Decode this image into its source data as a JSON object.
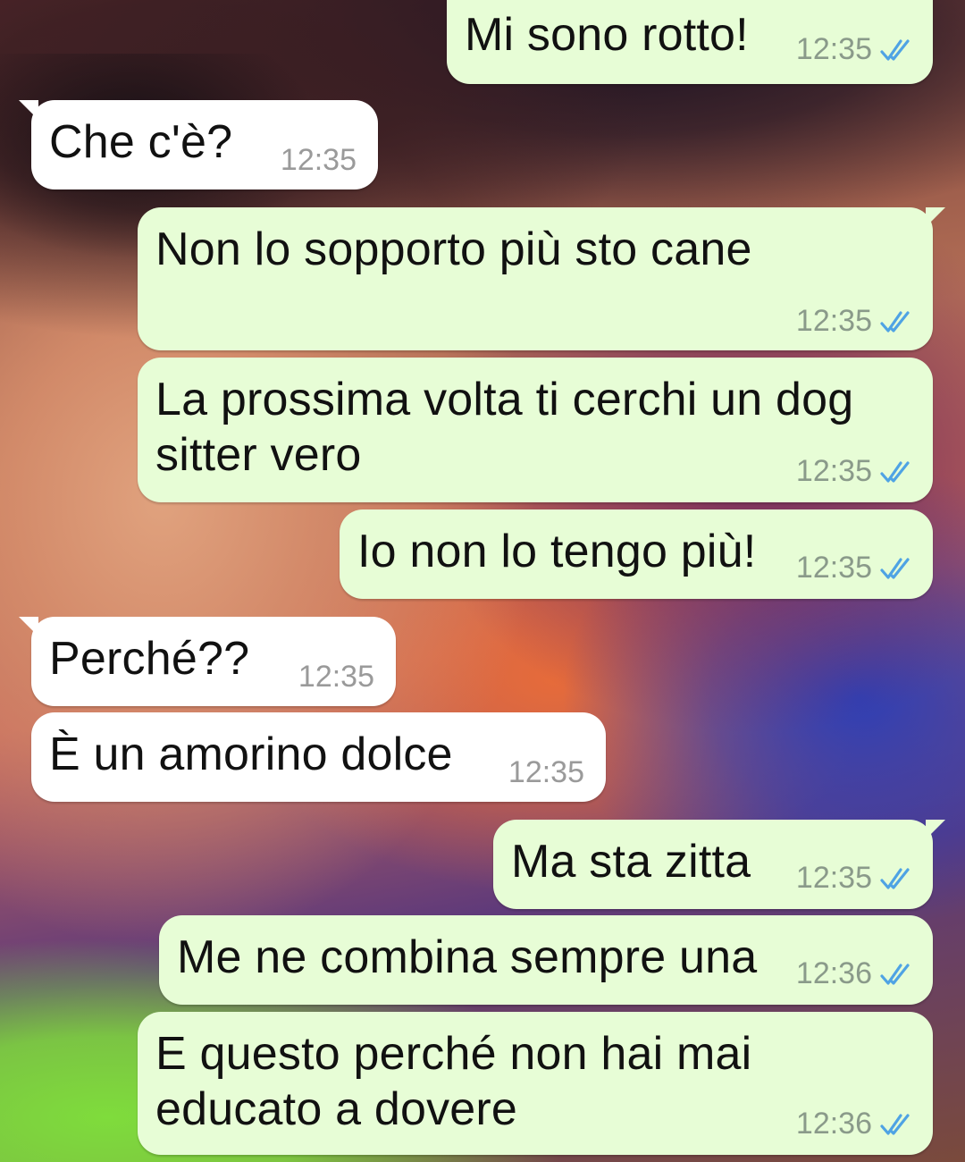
{
  "colors": {
    "outgoing_bubble": "#e7fdd6",
    "incoming_bubble": "#ffffff",
    "read_ticks": "#4fa3e4"
  },
  "messages": [
    {
      "direction": "out",
      "text": "Mi sono rotto!",
      "time": "12:35",
      "status_icon": "double-check-read-icon"
    },
    {
      "direction": "in",
      "text": "Che c'è?",
      "time": "12:35"
    },
    {
      "direction": "out",
      "text": "Non lo sopporto più sto cane",
      "time": "12:35",
      "status_icon": "double-check-read-icon"
    },
    {
      "direction": "out",
      "text": "La prossima volta ti cerchi un dog\nsitter vero",
      "time": "12:35",
      "status_icon": "double-check-read-icon"
    },
    {
      "direction": "out",
      "text": "Io non lo tengo più!",
      "time": "12:35",
      "status_icon": "double-check-read-icon"
    },
    {
      "direction": "in",
      "text": "Perché??",
      "time": "12:35"
    },
    {
      "direction": "in",
      "text": "È un amorino dolce",
      "time": "12:35"
    },
    {
      "direction": "out",
      "text": "Ma sta zitta",
      "time": "12:35",
      "status_icon": "double-check-read-icon"
    },
    {
      "direction": "out",
      "text": "Me ne combina sempre una",
      "time": "12:36",
      "status_icon": "double-check-read-icon"
    },
    {
      "direction": "out",
      "text": "E questo perché non hai mai\neducato a dovere",
      "time": "12:36",
      "status_icon": "double-check-read-icon"
    }
  ]
}
